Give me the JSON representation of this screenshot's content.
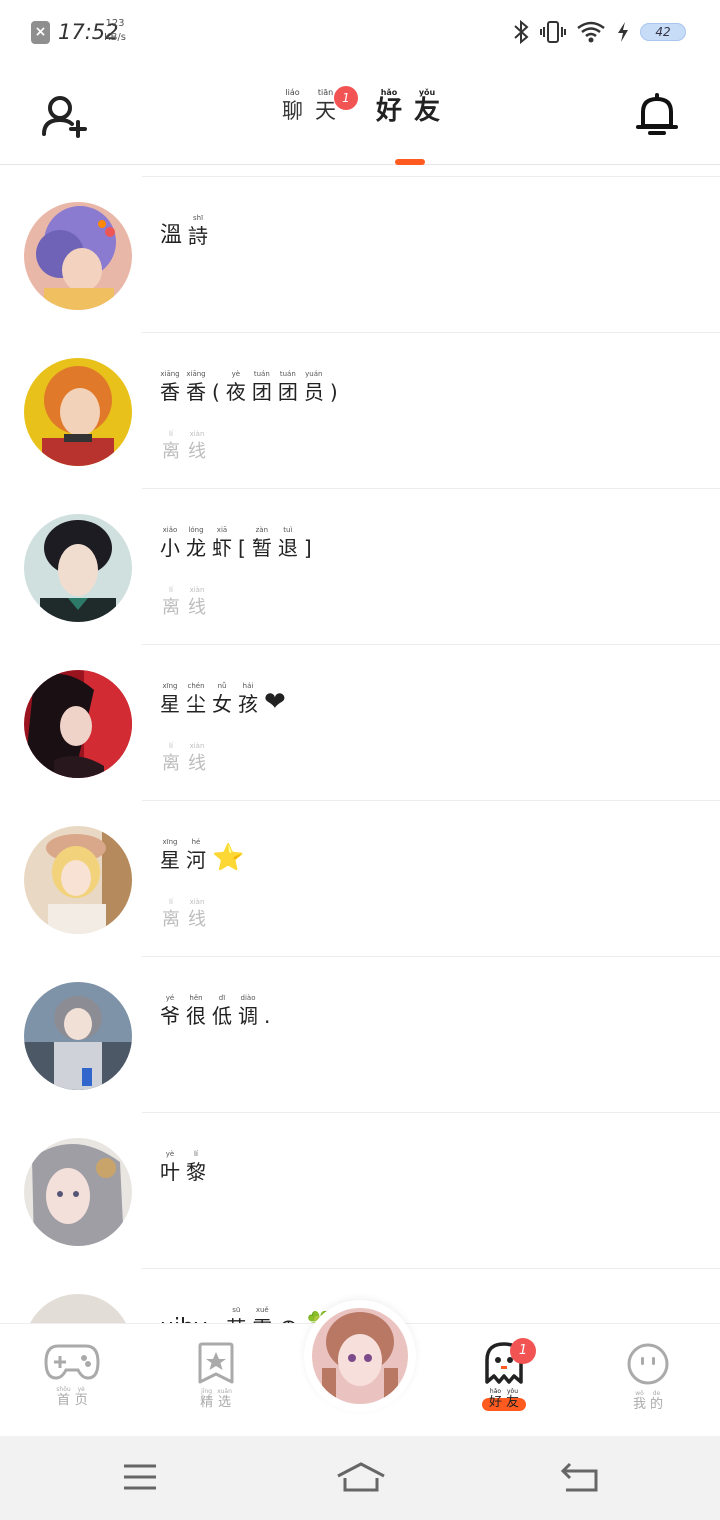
{
  "status_bar": {
    "time": "17:52",
    "net_speed_value": "123",
    "net_speed_unit": "KB/s",
    "battery": "42"
  },
  "header": {
    "tabs": [
      {
        "chars": [
          {
            "hz": "聊",
            "py": "liáo"
          },
          {
            "hz": "天",
            "py": "tiān"
          }
        ],
        "badge": "1"
      },
      {
        "chars": [
          {
            "hz": "好",
            "py": "hǎo"
          },
          {
            "hz": "友",
            "py": "yǒu"
          }
        ],
        "badge": ""
      }
    ]
  },
  "friends": [
    {
      "name_plain": "溫",
      "name_chars": [
        {
          "hz": "詩",
          "py": "shī"
        }
      ],
      "emoji": "",
      "status": []
    },
    {
      "name_plain": "",
      "name_chars": [
        {
          "hz": "香",
          "py": "xiāng"
        },
        {
          "hz": "香",
          "py": "xiāng"
        },
        {
          "hz": "(",
          "py": ""
        },
        {
          "hz": "夜",
          "py": "yè"
        },
        {
          "hz": "团",
          "py": "tuán"
        },
        {
          "hz": "团",
          "py": "tuán"
        },
        {
          "hz": "员",
          "py": "yuán"
        },
        {
          "hz": ")",
          "py": ""
        }
      ],
      "emoji": "",
      "status": [
        {
          "hz": "离",
          "py": "lí"
        },
        {
          "hz": "线",
          "py": "xiàn"
        }
      ]
    },
    {
      "name_plain": "",
      "name_chars": [
        {
          "hz": "小",
          "py": "xiǎo"
        },
        {
          "hz": "龙",
          "py": "lóng"
        },
        {
          "hz": "虾",
          "py": "xiā"
        },
        {
          "hz": "[",
          "py": ""
        },
        {
          "hz": "暂",
          "py": "zàn"
        },
        {
          "hz": "退",
          "py": "tuì"
        },
        {
          "hz": "]",
          "py": ""
        }
      ],
      "emoji": "",
      "status": [
        {
          "hz": "离",
          "py": "lí"
        },
        {
          "hz": "线",
          "py": "xiàn"
        }
      ]
    },
    {
      "name_plain": "",
      "name_chars": [
        {
          "hz": "星",
          "py": "xīng"
        },
        {
          "hz": "尘",
          "py": "chén"
        },
        {
          "hz": "女",
          "py": "nǚ"
        },
        {
          "hz": "孩",
          "py": "hái"
        }
      ],
      "emoji": "❤",
      "status": [
        {
          "hz": "离",
          "py": "lí"
        },
        {
          "hz": "线",
          "py": "xiàn"
        }
      ]
    },
    {
      "name_plain": "",
      "name_chars": [
        {
          "hz": "星",
          "py": "xīng"
        },
        {
          "hz": "河",
          "py": "hé"
        }
      ],
      "emoji": "⭐",
      "status": [
        {
          "hz": "离",
          "py": "lí"
        },
        {
          "hz": "线",
          "py": "xiàn"
        }
      ]
    },
    {
      "name_plain": "",
      "name_chars": [
        {
          "hz": "爷",
          "py": "yé"
        },
        {
          "hz": "很",
          "py": "hěn"
        },
        {
          "hz": "低",
          "py": "dī"
        },
        {
          "hz": "调",
          "py": "diào"
        },
        {
          "hz": ".",
          "py": ""
        }
      ],
      "emoji": "",
      "status": []
    },
    {
      "name_plain": "",
      "name_chars": [
        {
          "hz": "叶",
          "py": "yè"
        },
        {
          "hz": "黎",
          "py": "lí"
        }
      ],
      "emoji": "",
      "status": []
    },
    {
      "name_plain": "uiby",
      "name_chars": [
        {
          "hz": "-",
          "py": ""
        },
        {
          "hz": "苏",
          "py": "sū"
        },
        {
          "hz": "雪",
          "py": "xuě"
        },
        {
          "hz": "の",
          "py": ""
        }
      ],
      "emoji": "🍀",
      "status": []
    }
  ],
  "bottom_nav": {
    "items": [
      {
        "chars": [
          {
            "hz": "首",
            "py": "shǒu"
          },
          {
            "hz": "页",
            "py": "yè"
          }
        ],
        "icon": "gamepad-icon"
      },
      {
        "chars": [
          {
            "hz": "精",
            "py": "jīng"
          },
          {
            "hz": "选",
            "py": "xuǎn"
          }
        ],
        "icon": "bookmark-star-icon"
      },
      {
        "chars": [
          {
            "hz": "好",
            "py": "hǎo"
          },
          {
            "hz": "友",
            "py": "yǒu"
          }
        ],
        "icon": "ghost-icon",
        "badge": "1"
      },
      {
        "chars": [
          {
            "hz": "我",
            "py": "wǒ"
          },
          {
            "hz": "的",
            "py": "de"
          }
        ],
        "icon": "smiley-face-icon"
      }
    ]
  },
  "colors": {
    "accent": "#ff5a1f",
    "badge": "#f25454",
    "offline_text": "#bdbdbd"
  }
}
